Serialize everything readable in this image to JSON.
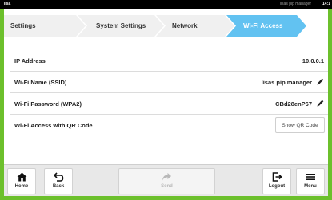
{
  "statusbar": {
    "device_name": "lisa",
    "user": "lisas pip manager",
    "time": "14:1"
  },
  "breadcrumb": {
    "items": [
      {
        "label": "Settings"
      },
      {
        "label": "System Settings"
      },
      {
        "label": "Network"
      },
      {
        "label": "Wi-Fi Access",
        "active": true
      }
    ],
    "active_color": "#62c2f1"
  },
  "settings": {
    "ip_address": {
      "label": "IP Address",
      "value": "10.0.0.1"
    },
    "ssid": {
      "label": "Wi-Fi Name (SSID)",
      "value": "lisas pip manager",
      "icon": "pencil-icon"
    },
    "password": {
      "label": "Wi-Fi Password (WPA2)",
      "value": "CBd28enP67",
      "icon": "pencil-icon"
    },
    "qr": {
      "label": "Wi-Fi Access with QR Code",
      "button_label": "Show QR Code"
    }
  },
  "toolbar": {
    "home": {
      "label": "Home",
      "icon": "house-icon"
    },
    "back": {
      "label": "Back",
      "icon": "back-arrow-icon"
    },
    "send": {
      "label": "Send",
      "icon": "share-arrow-icon",
      "disabled": true
    },
    "logout": {
      "label": "Logout",
      "icon": "logout-icon"
    },
    "menu": {
      "label": "Menu",
      "icon": "hamburger-icon"
    }
  },
  "colors": {
    "frame": "#6cc02c",
    "accent": "#62c2f1"
  }
}
